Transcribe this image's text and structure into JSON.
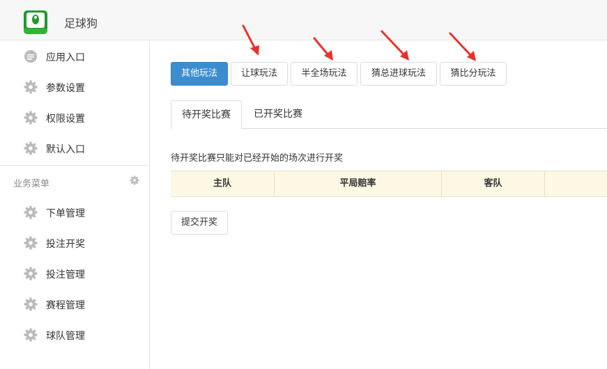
{
  "header": {
    "app_title": "足球狗",
    "logo_icon": "app-logo-icon"
  },
  "sidebar": {
    "top_items": [
      {
        "label": "应用入口",
        "icon": "chat-bubble-icon"
      },
      {
        "label": "参数设置",
        "icon": "gear-icon"
      },
      {
        "label": "权限设置",
        "icon": "gear-icon"
      },
      {
        "label": "默认入口",
        "icon": "gear-icon"
      }
    ],
    "section_title": "业务菜单",
    "section_items": [
      {
        "label": "下单管理",
        "icon": "gear-icon"
      },
      {
        "label": "投注开奖",
        "icon": "gear-icon"
      },
      {
        "label": "投注管理",
        "icon": "gear-icon"
      },
      {
        "label": "赛程管理",
        "icon": "gear-icon"
      },
      {
        "label": "球队管理",
        "icon": "gear-icon"
      }
    ]
  },
  "main": {
    "play_types": [
      {
        "label": "其他玩法",
        "active": true
      },
      {
        "label": "让球玩法",
        "active": false
      },
      {
        "label": "半全场玩法",
        "active": false
      },
      {
        "label": "猜总进球玩法",
        "active": false
      },
      {
        "label": "猜比分玩法",
        "active": false
      }
    ],
    "tabs": [
      {
        "label": "待开奖比赛",
        "active": true
      },
      {
        "label": "已开奖比赛",
        "active": false
      }
    ],
    "hint": "待开奖比赛只能对已经开始的场次进行开奖",
    "table": {
      "columns": [
        "主队",
        "平局赔率",
        "客队",
        ""
      ]
    },
    "submit_label": "提交开奖"
  },
  "colors": {
    "primary": "#3c8dd0",
    "table_header_bg": "#fdf8e4",
    "arrow": "#e8322d",
    "logo_green": "#1f9a2a"
  }
}
